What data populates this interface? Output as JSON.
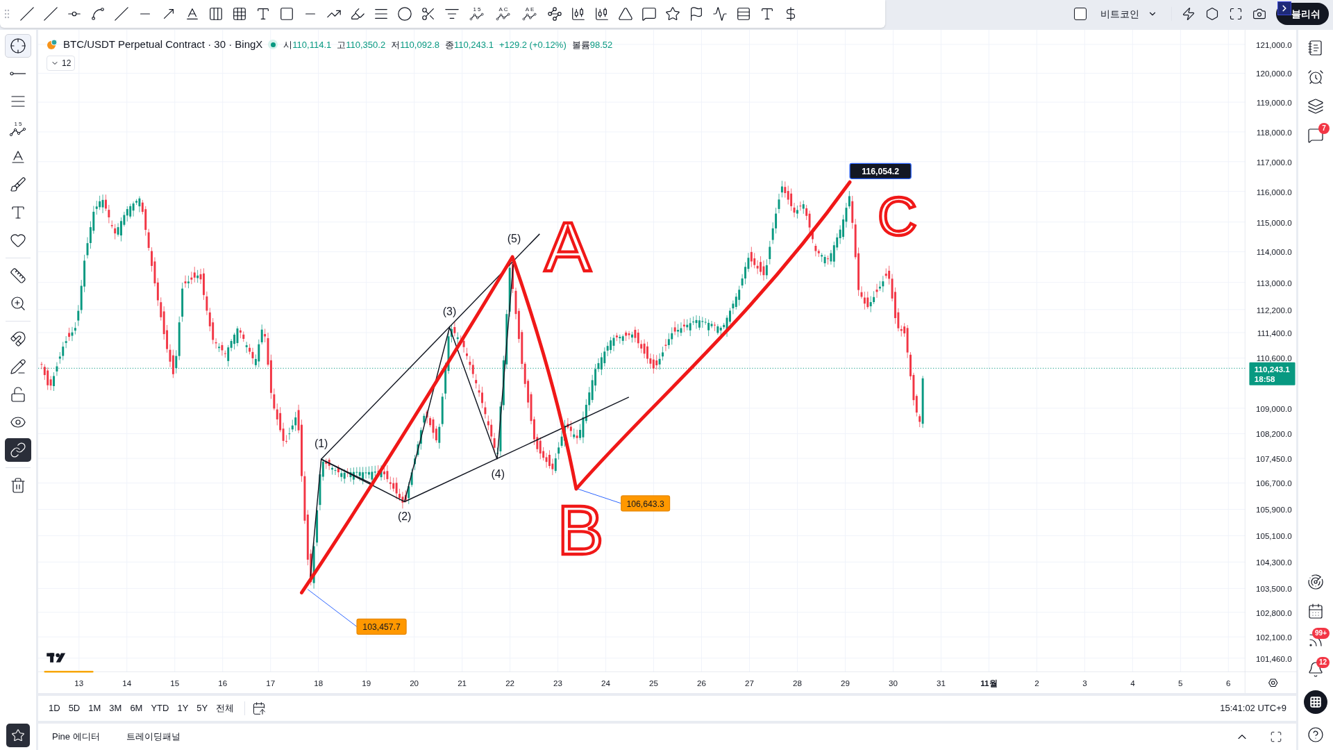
{
  "toolbar": {
    "tool_labels": [
      "1 5",
      "A C",
      "A E"
    ],
    "symbol_checkbox": {
      "checked": false
    },
    "symbol_select": "비트코인",
    "publish_button": "블리쉬"
  },
  "legend": {
    "symbol": "BTC/USDT Perpetual Contract · 30 · BingX",
    "market_open": true,
    "ohlc": [
      {
        "label": "시",
        "value": "110,114.1"
      },
      {
        "label": "고",
        "value": "110,350.2"
      },
      {
        "label": "저",
        "value": "110,092.8"
      },
      {
        "label": "종",
        "value": "110,243.1"
      }
    ],
    "change": "+129.2 (+0.12%)",
    "volume_label": "볼륨",
    "volume": "98.52",
    "collapse_count": "12"
  },
  "left_toolbar": [
    {
      "selected": true,
      "on": false
    },
    {
      "selected": false,
      "on": false
    },
    {
      "selected": false,
      "on": false
    },
    {
      "selected": false,
      "on": false,
      "label": "1 5"
    },
    {
      "selected": false,
      "on": false
    },
    {
      "selected": false,
      "on": false
    },
    {
      "selected": false,
      "on": false
    },
    {
      "selected": false,
      "on": false
    },
    {
      "selected": false,
      "on": false
    },
    {
      "selected": false,
      "on": false
    },
    {
      "selected": false,
      "on": false
    },
    {
      "selected": false,
      "on": false
    },
    {
      "selected": false,
      "on": false
    },
    {
      "selected": false,
      "on": false
    },
    {
      "selected": false,
      "on": true
    },
    {
      "selected": false,
      "on": false
    }
  ],
  "price_axis": {
    "ticks": [
      "121,000.0",
      "120,000.0",
      "119,000.0",
      "118,000.0",
      "117,000.0",
      "116,000.0",
      "115,000.0",
      "114,000.0",
      "113,000.0",
      "112,200.0",
      "111,400.0",
      "110,600.0",
      "109,000.0",
      "108,200.0",
      "107,450.0",
      "106,700.0",
      "105,900.0",
      "105,100.0",
      "104,300.0",
      "103,500.0",
      "102,800.0",
      "102,100.0",
      "101,460.0"
    ],
    "current_price": "110,243.1",
    "countdown": "18:58"
  },
  "time_axis": [
    {
      "label": "13",
      "kind": "day"
    },
    {
      "label": "14",
      "kind": "day"
    },
    {
      "label": "15",
      "kind": "day"
    },
    {
      "label": "16",
      "kind": "day"
    },
    {
      "label": "17",
      "kind": "day"
    },
    {
      "label": "18",
      "kind": "day"
    },
    {
      "label": "19",
      "kind": "day"
    },
    {
      "label": "20",
      "kind": "day"
    },
    {
      "label": "21",
      "kind": "day"
    },
    {
      "label": "22",
      "kind": "day"
    },
    {
      "label": "23",
      "kind": "day"
    },
    {
      "label": "24",
      "kind": "day"
    },
    {
      "label": "25",
      "kind": "day"
    },
    {
      "label": "26",
      "kind": "day"
    },
    {
      "label": "27",
      "kind": "day"
    },
    {
      "label": "28",
      "kind": "day"
    },
    {
      "label": "29",
      "kind": "day"
    },
    {
      "label": "30",
      "kind": "day"
    },
    {
      "label": "31",
      "kind": "day"
    },
    {
      "label": "11월",
      "kind": "month"
    },
    {
      "label": "2",
      "kind": "day"
    },
    {
      "label": "3",
      "kind": "day"
    },
    {
      "label": "4",
      "kind": "day"
    },
    {
      "label": "5",
      "kind": "day"
    },
    {
      "label": "6",
      "kind": "day"
    }
  ],
  "annotations": {
    "wave_labels": [
      "(1)",
      "(2)",
      "(3)",
      "(4)",
      "(5)"
    ],
    "letters": [
      "A",
      "B",
      "C"
    ],
    "price_tags": [
      {
        "label": "103,457.7",
        "kind": "low"
      },
      {
        "label": "106,643.3",
        "kind": "low"
      },
      {
        "label": "116,054.2",
        "kind": "high"
      }
    ]
  },
  "right_sidebar": {
    "chat_badge": "7",
    "news_badge": "99+",
    "alerts_badge": "12"
  },
  "range_bar": {
    "ranges": [
      "1D",
      "5D",
      "1M",
      "3M",
      "6M",
      "YTD",
      "1Y",
      "5Y",
      "전체"
    ],
    "clock": "15:41:02 UTC+9"
  },
  "bottom_panel": {
    "tabs": [
      "Pine 에디터",
      "트레이딩패널"
    ]
  }
}
